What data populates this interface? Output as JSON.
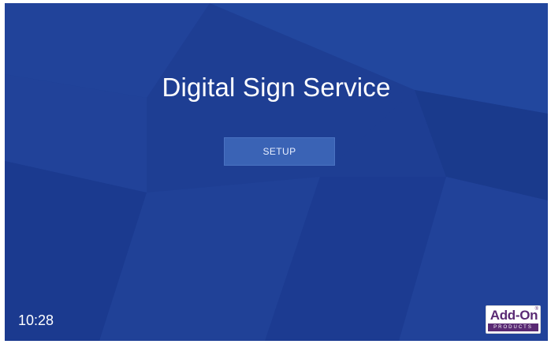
{
  "app": {
    "title": "Digital Sign Service"
  },
  "actions": {
    "setup_label": "SETUP"
  },
  "status": {
    "time": "10:28"
  },
  "logo": {
    "main": "Add-On",
    "sub": "PRODUCTS",
    "reg": "®"
  },
  "colors": {
    "background": "#1f3f95",
    "button": "#3a63b5",
    "logo_accent": "#5a2a74"
  }
}
